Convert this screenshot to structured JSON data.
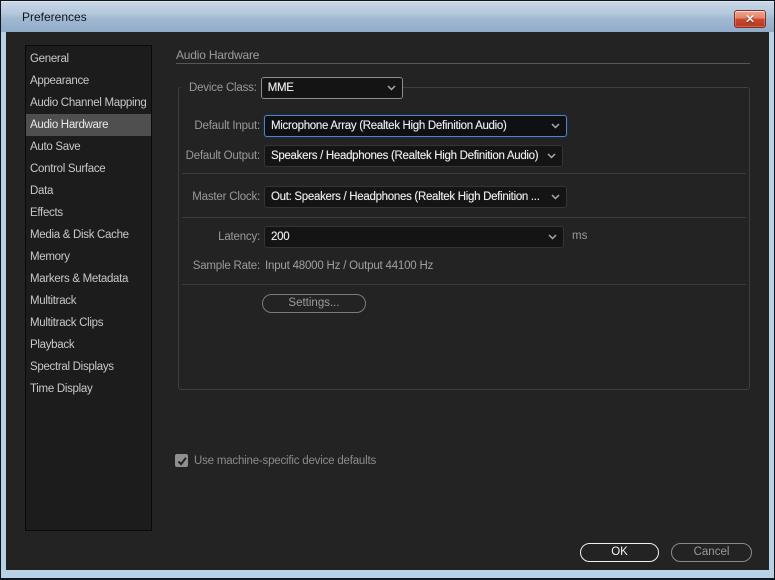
{
  "window": {
    "title": "Preferences",
    "close_icon": "x"
  },
  "sidebar": {
    "items": [
      {
        "label": "General",
        "selected": false
      },
      {
        "label": "Appearance",
        "selected": false
      },
      {
        "label": "Audio Channel Mapping",
        "selected": false
      },
      {
        "label": "Audio Hardware",
        "selected": true
      },
      {
        "label": "Auto Save",
        "selected": false
      },
      {
        "label": "Control Surface",
        "selected": false
      },
      {
        "label": "Data",
        "selected": false
      },
      {
        "label": "Effects",
        "selected": false
      },
      {
        "label": "Media & Disk Cache",
        "selected": false
      },
      {
        "label": "Memory",
        "selected": false
      },
      {
        "label": "Markers & Metadata",
        "selected": false
      },
      {
        "label": "Multitrack",
        "selected": false
      },
      {
        "label": "Multitrack Clips",
        "selected": false
      },
      {
        "label": "Playback",
        "selected": false
      },
      {
        "label": "Spectral Displays",
        "selected": false
      },
      {
        "label": "Time Display",
        "selected": false
      }
    ]
  },
  "panel": {
    "title": "Audio Hardware",
    "device_class": {
      "label": "Device Class:",
      "value": "MME"
    },
    "default_input": {
      "label": "Default Input:",
      "value": "Microphone Array (Realtek High Definition Audio)",
      "focused": true
    },
    "default_output": {
      "label": "Default Output:",
      "value": "Speakers / Headphones (Realtek High Definition Audio)"
    },
    "master_clock": {
      "label": "Master Clock:",
      "value": "Out: Speakers / Headphones (Realtek High Definition ..."
    },
    "latency": {
      "label": "Latency:",
      "value": "200",
      "suffix": "ms"
    },
    "sample_rate": {
      "label": "Sample Rate:",
      "value": "Input 48000 Hz / Output 44100 Hz"
    },
    "settings_button": "Settings..."
  },
  "checkbox": {
    "label": "Use machine-specific device defaults",
    "checked": true
  },
  "footer": {
    "ok": "OK",
    "cancel": "Cancel"
  },
  "colors": {
    "focus_border": "#4e80d4",
    "content_bg": "#232323",
    "selected_bg": "#4f4f4f",
    "close_red": "#b53922"
  }
}
